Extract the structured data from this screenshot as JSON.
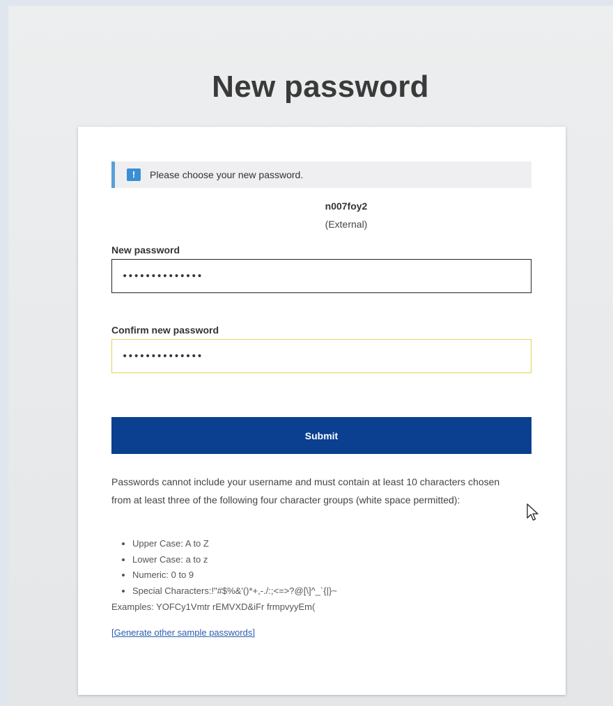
{
  "page": {
    "title": "New password"
  },
  "notice": {
    "icon": "exclamation-icon",
    "text": "Please choose your new password."
  },
  "account": {
    "username": "n007foy2",
    "type": "(External)"
  },
  "form": {
    "new_password": {
      "label": "New password",
      "value": "••••••••••••••"
    },
    "confirm_password": {
      "label": "Confirm new password",
      "value": "••••••••••••••"
    },
    "submit_label": "Submit"
  },
  "rules": {
    "intro": "Passwords cannot include your username and must contain at least 10 characters chosen from at least three of the following four character groups (white space permitted):",
    "items": [
      "Upper Case: A to Z",
      "Lower Case: a to z",
      "Numeric: 0 to 9",
      "Special Characters:!\"#$%&'()*+,-./:;<=>?@[\\]^_`{|}~"
    ],
    "examples": "Examples: YOFCy1Vmtr rEMVXD&iFr frmpvyyEm(",
    "generate_link": "[Generate other sample passwords]"
  },
  "colors": {
    "primary_button": "#0b3f8f",
    "notice_accent": "#5aa0d8",
    "link": "#2a5db0",
    "focus_border": "#e3d25a"
  }
}
